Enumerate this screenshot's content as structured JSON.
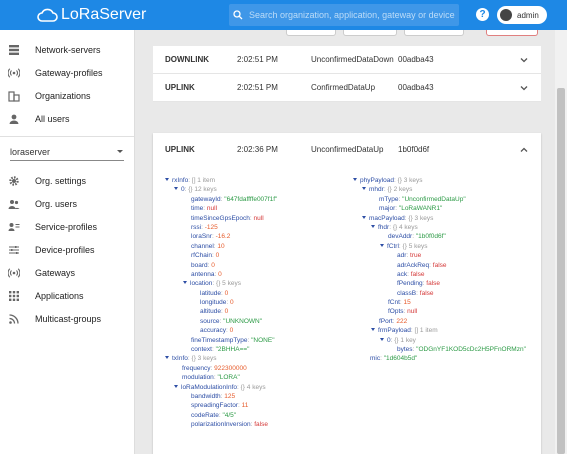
{
  "app": {
    "title": "LoRaServer",
    "brand_color": "#1e88e5"
  },
  "search": {
    "placeholder": "Search organization, application, gateway or device"
  },
  "user": {
    "name": "admin"
  },
  "sidebar": {
    "top_items": [
      {
        "label": "Network-servers",
        "icon": "server-icon"
      },
      {
        "label": "Gateway-profiles",
        "icon": "wifi-icon"
      },
      {
        "label": "Organizations",
        "icon": "domain-icon"
      },
      {
        "label": "All users",
        "icon": "person-icon"
      }
    ],
    "org_select": "loraserver",
    "org_items": [
      {
        "label": "Org. settings",
        "icon": "gear-icon"
      },
      {
        "label": "Org. users",
        "icon": "people-icon"
      },
      {
        "label": "Service-profiles",
        "icon": "account-details-icon"
      },
      {
        "label": "Device-profiles",
        "icon": "tune-icon"
      },
      {
        "label": "Gateways",
        "icon": "wifi-icon"
      },
      {
        "label": "Applications",
        "icon": "apps-icon"
      },
      {
        "label": "Multicast-groups",
        "icon": "rss-icon"
      }
    ]
  },
  "frames": [
    {
      "direction": "DOWNLINK",
      "time": "2:02:51 PM",
      "type": "UnconfirmedDataDown",
      "devaddr": "00adba43"
    },
    {
      "direction": "UPLINK",
      "time": "2:02:51 PM",
      "type": "ConfirmedDataUp",
      "devaddr": "00adba43"
    },
    {
      "direction": "UPLINK",
      "time": "2:02:36 PM",
      "type": "UnconfirmedDataUp",
      "devaddr": "1b0f0d6f"
    }
  ],
  "tree_left": [
    {
      "d": 0,
      "arrow": true,
      "key": "rxInfo",
      "meta": "[] 1 item"
    },
    {
      "d": 1,
      "arrow": true,
      "key": "0",
      "meta": "{} 12 keys"
    },
    {
      "d": 2,
      "key": "gatewayId",
      "val": "\"647fdaffffe007f1f\"",
      "t": "s"
    },
    {
      "d": 2,
      "key": "time",
      "val": "null",
      "t": "b"
    },
    {
      "d": 2,
      "key": "timeSinceGpsEpoch",
      "val": "null",
      "t": "b"
    },
    {
      "d": 2,
      "key": "rssi",
      "val": "-125",
      "t": "num"
    },
    {
      "d": 2,
      "key": "loraSnr",
      "val": "-16.2",
      "t": "num"
    },
    {
      "d": 2,
      "key": "channel",
      "val": "10",
      "t": "num"
    },
    {
      "d": 2,
      "key": "rfChain",
      "val": "0",
      "t": "num"
    },
    {
      "d": 2,
      "key": "board",
      "val": "0",
      "t": "num"
    },
    {
      "d": 2,
      "key": "antenna",
      "val": "0",
      "t": "num"
    },
    {
      "d": 2,
      "arrow": true,
      "key": "location",
      "meta": "{} 5 keys"
    },
    {
      "d": 3,
      "key": "latitude",
      "val": "0",
      "t": "num"
    },
    {
      "d": 3,
      "key": "longitude",
      "val": "0",
      "t": "num"
    },
    {
      "d": 3,
      "key": "altitude",
      "val": "0",
      "t": "num"
    },
    {
      "d": 3,
      "key": "source",
      "val": "\"UNKNOWN\"",
      "t": "s"
    },
    {
      "d": 3,
      "key": "accuracy",
      "val": "0",
      "t": "num"
    },
    {
      "d": 2,
      "key": "fineTimestampType",
      "val": "\"NONE\"",
      "t": "s"
    },
    {
      "d": 2,
      "key": "context",
      "val": "\"2BHHA==\"",
      "t": "s"
    },
    {
      "d": 0,
      "arrow": true,
      "key": "txInfo",
      "meta": "{} 3 keys"
    },
    {
      "d": 1,
      "key": "frequency",
      "val": "922300000",
      "t": "num"
    },
    {
      "d": 1,
      "key": "modulation",
      "val": "\"LORA\"",
      "t": "s"
    },
    {
      "d": 1,
      "arrow": true,
      "key": "loRaModulationInfo",
      "meta": "{} 4 keys"
    },
    {
      "d": 2,
      "key": "bandwidth",
      "val": "125",
      "t": "num"
    },
    {
      "d": 2,
      "key": "spreadingFactor",
      "val": "11",
      "t": "num"
    },
    {
      "d": 2,
      "key": "codeRate",
      "val": "\"4/5\"",
      "t": "s"
    },
    {
      "d": 2,
      "key": "polarizationInversion",
      "val": "false",
      "t": "b"
    }
  ],
  "tree_right": [
    {
      "d": 0,
      "arrow": true,
      "key": "phyPayload",
      "meta": "{} 3 keys"
    },
    {
      "d": 1,
      "arrow": true,
      "key": "mhdr",
      "meta": "{} 2 keys"
    },
    {
      "d": 2,
      "key": "mType",
      "val": "\"UnconfirmedDataUp\"",
      "t": "s"
    },
    {
      "d": 2,
      "key": "major",
      "val": "\"LoRaWANR1\"",
      "t": "s"
    },
    {
      "d": 1,
      "arrow": true,
      "key": "macPayload",
      "meta": "{} 3 keys"
    },
    {
      "d": 2,
      "arrow": true,
      "key": "fhdr",
      "meta": "{} 4 keys"
    },
    {
      "d": 3,
      "key": "devAddr",
      "val": "\"1b0f0d6f\"",
      "t": "s"
    },
    {
      "d": 3,
      "arrow": true,
      "key": "fCtrl",
      "meta": "{} 5 keys"
    },
    {
      "d": 4,
      "key": "adr",
      "val": "true",
      "t": "b"
    },
    {
      "d": 4,
      "key": "adrAckReq",
      "val": "false",
      "t": "b"
    },
    {
      "d": 4,
      "key": "ack",
      "val": "false",
      "t": "b"
    },
    {
      "d": 4,
      "key": "fPending",
      "val": "false",
      "t": "b"
    },
    {
      "d": 4,
      "key": "classB",
      "val": "false",
      "t": "b"
    },
    {
      "d": 3,
      "key": "fCnt",
      "val": "15",
      "t": "num"
    },
    {
      "d": 3,
      "key": "fOpts",
      "val": "null",
      "t": "b"
    },
    {
      "d": 2,
      "key": "fPort",
      "val": "222",
      "t": "num"
    },
    {
      "d": 2,
      "arrow": true,
      "key": "frmPayload",
      "meta": "[] 1 item"
    },
    {
      "d": 3,
      "arrow": true,
      "key": "0",
      "meta": "{} 1 key"
    },
    {
      "d": 4,
      "key": "bytes",
      "val": "\"ODGnYF1KOD5cDc2H5PFnORMzn\"",
      "t": "s"
    },
    {
      "d": 1,
      "key": "mic",
      "val": "\"1d604b5d\"",
      "t": "s"
    }
  ]
}
